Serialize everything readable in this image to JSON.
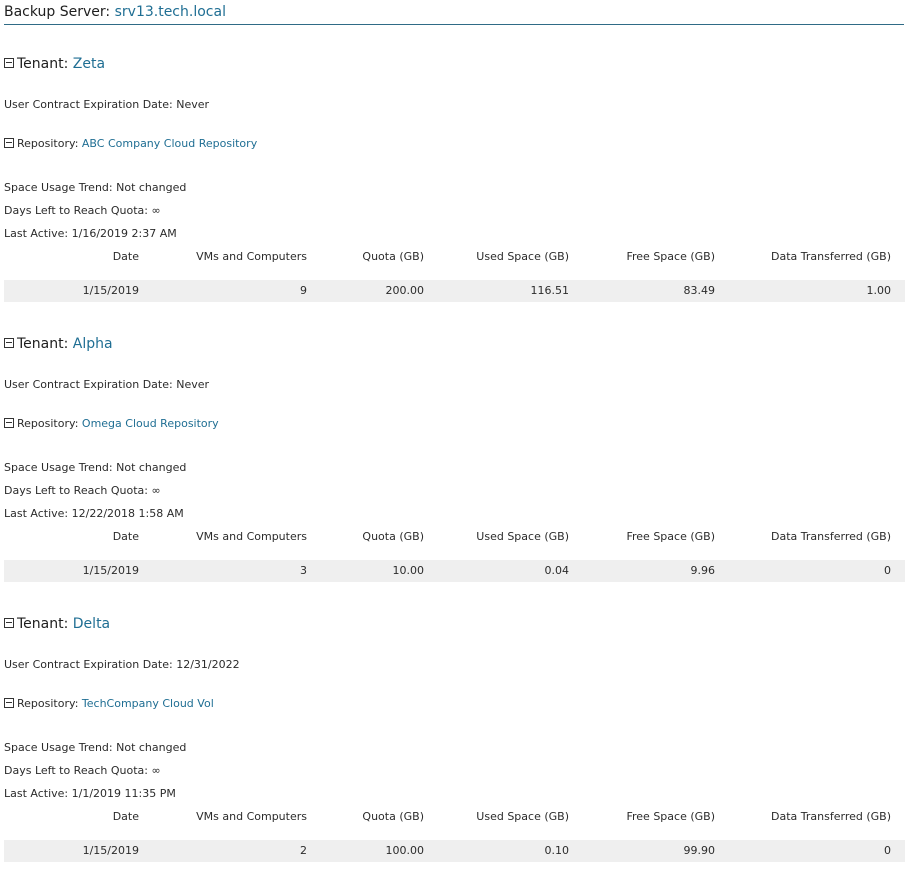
{
  "header": {
    "prefix": "Backup Server: ",
    "server": "srv13.tech.local"
  },
  "labels": {
    "tenant": "Tenant:",
    "contract": "User Contract Expiration Date: ",
    "repository": "Repository: ",
    "trend": "Space Usage Trend: ",
    "days": "Days Left to Reach Quota: ",
    "active": "Last Active: "
  },
  "columns": [
    "Date",
    "VMs and Computers",
    "Quota (GB)",
    "Used Space (GB)",
    "Free Space (GB)",
    "Data Transferred (GB)"
  ],
  "tenants": [
    {
      "name": "Zeta",
      "contract_expiration": "Never",
      "repository": "ABC Company Cloud Repository",
      "space_usage_trend": "Not changed",
      "days_left": "∞",
      "last_active": "1/16/2019 2:37 AM",
      "row": {
        "date": "1/15/2019",
        "vms": "9",
        "quota": "200.00",
        "used": "116.51",
        "free": "83.49",
        "transferred": "1.00"
      }
    },
    {
      "name": "Alpha",
      "contract_expiration": "Never",
      "repository": "Omega Cloud Repository",
      "space_usage_trend": "Not changed",
      "days_left": "∞",
      "last_active": "12/22/2018 1:58 AM",
      "row": {
        "date": "1/15/2019",
        "vms": "3",
        "quota": "10.00",
        "used": "0.04",
        "free": "9.96",
        "transferred": "0"
      }
    },
    {
      "name": "Delta",
      "contract_expiration": "12/31/2022",
      "repository": "TechCompany Cloud Vol",
      "space_usage_trend": "Not changed",
      "days_left": "∞",
      "last_active": "1/1/2019 11:35 PM",
      "row": {
        "date": "1/15/2019",
        "vms": "2",
        "quota": "100.00",
        "used": "0.10",
        "free": "99.90",
        "transferred": "0"
      }
    }
  ]
}
